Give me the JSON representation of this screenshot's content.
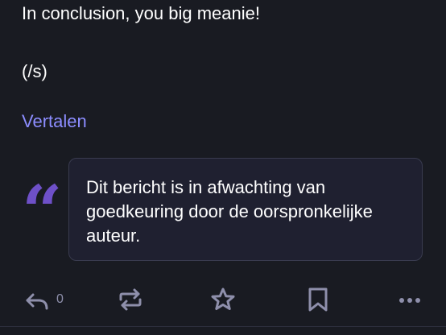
{
  "post": {
    "lines": [
      "In conclusion, you big meanie!",
      "(/s)"
    ],
    "translate_label": "Vertalen"
  },
  "pending_notice": {
    "icon": "quote-icon",
    "text": "Dit bericht is in afwachting van goedkeuring door de oorspronkelijke auteur."
  },
  "actions": {
    "reply_count": "0",
    "icons": [
      "reply-icon",
      "boost-icon",
      "favourite-icon",
      "bookmark-icon",
      "more-icon"
    ]
  },
  "colors": {
    "background": "#191b22",
    "link": "#8c8dff",
    "accent": "#6e50c8",
    "icon": "#8e8fab",
    "box_border": "#393b4f"
  }
}
